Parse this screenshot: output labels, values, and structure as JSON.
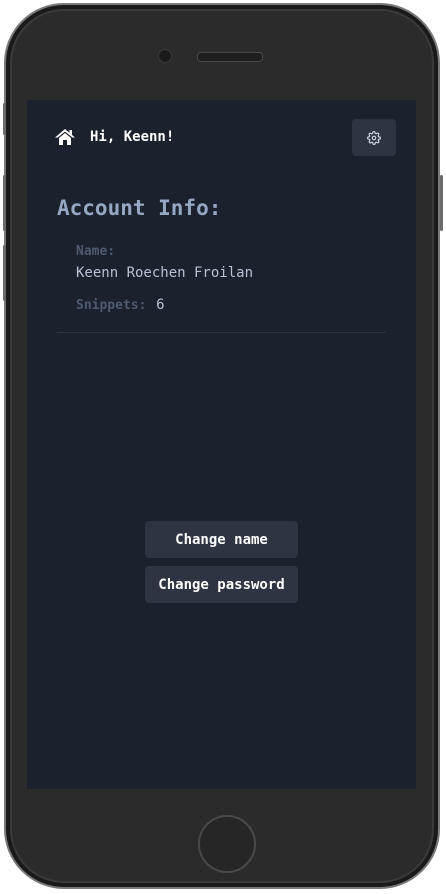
{
  "header": {
    "greeting": "Hi, Keenn!",
    "home_icon": "home-icon",
    "settings_icon": "gear-icon"
  },
  "account": {
    "title": "Account Info:",
    "name_label": "Name:",
    "name_value": "Keenn Roechen Froilan",
    "snippets_label": "Snippets:",
    "snippets_value": "6"
  },
  "actions": {
    "change_name": "Change name",
    "change_password": "Change password"
  },
  "colors": {
    "background": "#1c212e",
    "button": "#2e3441",
    "title": "#95a7c2",
    "label": "#4e5a6e",
    "value": "#b7c1d2"
  }
}
